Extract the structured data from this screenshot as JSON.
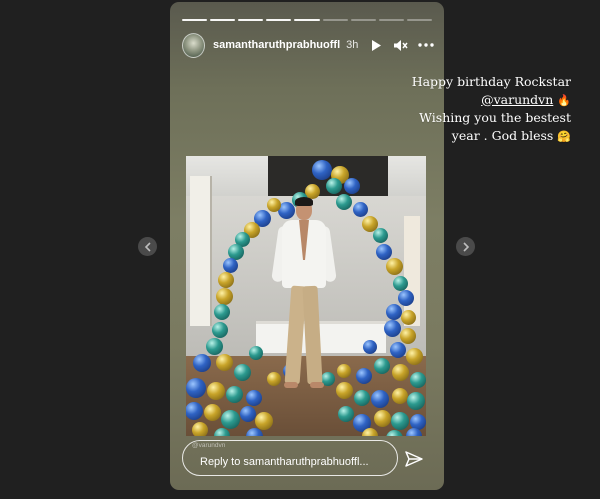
{
  "story": {
    "username": "samantharuthprabhuoffl",
    "time_ago": "3h",
    "segments_total": 9,
    "segments_done": 5,
    "controls": {
      "play_icon": "play-icon",
      "mute_icon": "muted-speaker-icon",
      "more_icon": "more-dots-icon"
    }
  },
  "caption": {
    "line1": "Happy birthday Rockstar",
    "mention": "@varundvn",
    "fire_emoji": "🔥",
    "line3": "Wishing you the bestest",
    "line4": "year . God bless",
    "hug_emoji": "🤗"
  },
  "photo": {
    "balloon_colors": {
      "blue": "#2f63c4",
      "gold": "#c8a429",
      "teal": "#2c9a8f"
    }
  },
  "reply": {
    "tagged_label": "@varundvn",
    "placeholder": "Reply to samantharuthprabhuoffl...",
    "send_icon": "send-icon"
  },
  "navigation": {
    "prev_icon": "chevron-left-icon",
    "next_icon": "chevron-right-icon"
  }
}
